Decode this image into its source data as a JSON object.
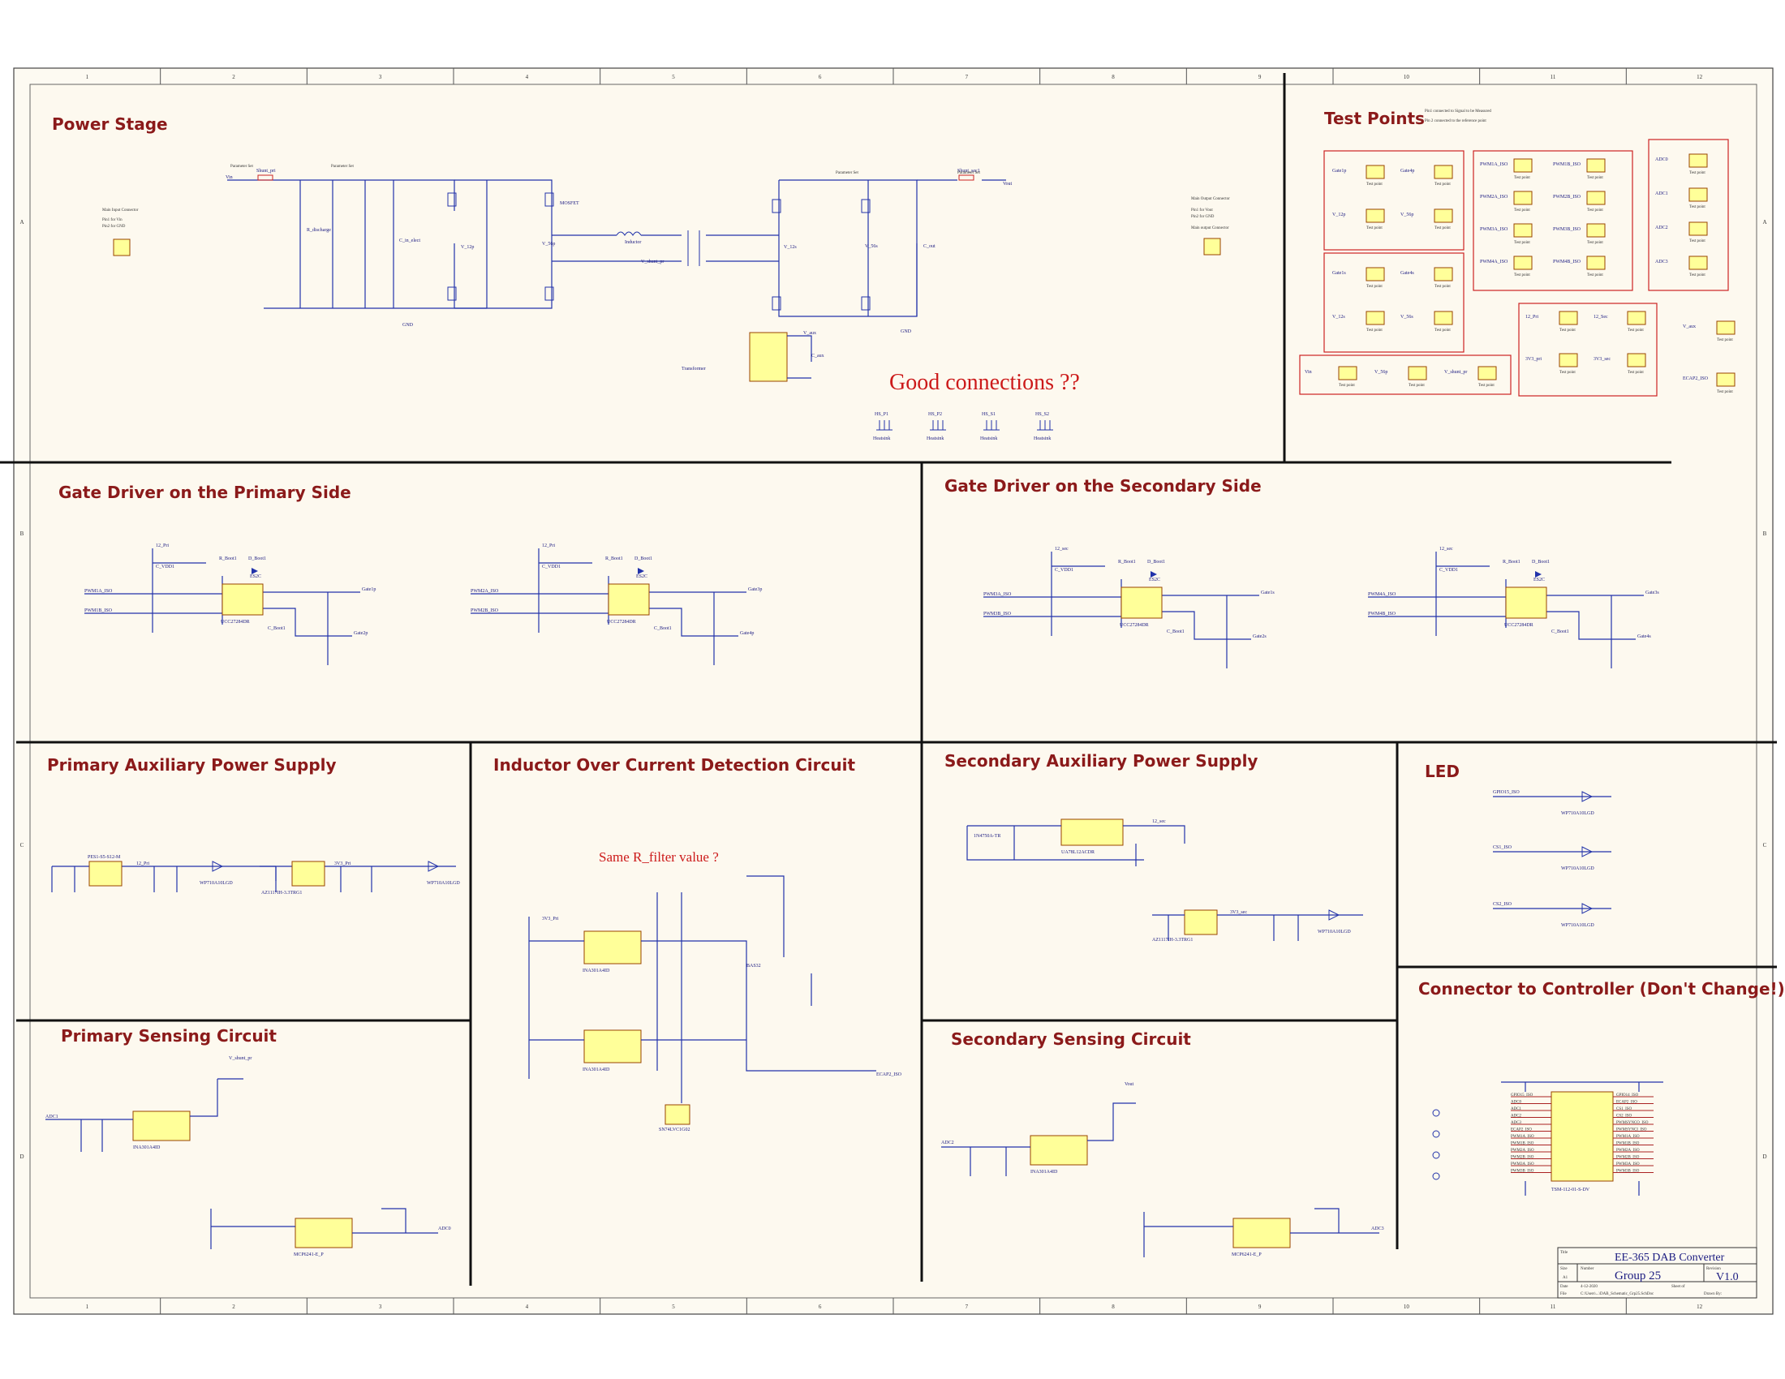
{
  "sections": {
    "power_stage": "Power Stage",
    "test_points": "Test Points",
    "gate_driver_primary": "Gate Driver on the Primary Side",
    "gate_driver_secondary": "Gate Driver on the Secondary Side",
    "primary_aux_supply": "Primary Auxiliary Power Supply",
    "inductor_oc": "Inductor Over Current Detection Circuit",
    "secondary_aux_supply": "Secondary Auxiliary Power Supply",
    "led": "LED",
    "primary_sensing": "Primary Sensing Circuit",
    "secondary_sensing": "Secondary Sensing Circuit",
    "connector_controller": "Connector to Controller (Don't Change!)"
  },
  "notes": {
    "good_connections": "Good connections ??",
    "same_r_filter": "Same R_filter value ?"
  },
  "power_stage": {
    "main_input_connector": "Main Input Connector",
    "pin1_vin": "Pin1 for Vin",
    "pin2_gnd": "Pin2 for GND",
    "main_output_connector": "Main Output Connector",
    "pin1_vout": "Pin1 for Vout",
    "pin2_gnd_out": "Pin2 for GND",
    "main_output_connector_2": "Main output Connector",
    "transformer": "Transformer",
    "inductor": "Inductor",
    "mosfet": "MOSFET",
    "heatsink": "Heatsink",
    "vin": "Vin",
    "vout": "Vout",
    "gnd": "GND",
    "shunt_pri": "Shunt_pri",
    "shunt_sec": "Shunt_sec1",
    "r_discharge": "R_discharge",
    "c_in_electrolytic": "C_in_elect",
    "c_out": "C_out",
    "c_aux": "C_aux",
    "parameter_set": "Parameter Set",
    "v_shunt_pr": "V_shunt_pr",
    "v_12p": "V_12p",
    "v_56p": "V_56p",
    "v_12s": "V_12s",
    "v_56s": "V_56s",
    "v_aux": "V_aux",
    "heatsink_refs": [
      "HS_P1",
      "HS_P2",
      "HS_S1",
      "HS_S2"
    ]
  },
  "test_points": {
    "pin1_note": "Pin1 connected to Signal to be Measured",
    "pin2_note": "Pin 2 connected to the reference point",
    "test_point_label": "Test point",
    "group_a": [
      "Gate1p",
      "Gate4p",
      "V_12p",
      "V_56p"
    ],
    "group_b": [
      "Gate1s",
      "Gate4s",
      "V_12s",
      "V_56s"
    ],
    "group_c": [
      "PWM1A_ISO",
      "PWM1B_ISO",
      "PWM2A_ISO",
      "PWM2B_ISO",
      "PWM3A_ISO",
      "PWM3B_ISO",
      "PWM4A_ISO",
      "PWM4B_ISO"
    ],
    "group_d": [
      "ADC0",
      "ADC1",
      "ADC2",
      "ADC3"
    ],
    "group_e": [
      "12_Pri",
      "12_Sec",
      "3V3_pri",
      "3V3_sec"
    ],
    "group_f": [
      "Vin",
      "V_56p",
      "V_shunt_pr"
    ],
    "single": [
      "V_aux",
      "ECAP2_ISO"
    ]
  },
  "gate_driver": {
    "driver_ic": "UCC27284DR",
    "diode": "ES2C",
    "pwm_1a": "PWM1A_ISO",
    "pwm_1b": "PWM1B_ISO",
    "pwm_2a": "PWM2A_ISO",
    "pwm_2b": "PWM2B_ISO",
    "pwm_3a": "PWM3A_ISO",
    "pwm_3b": "PWM3B_ISO",
    "pwm_4a": "PWM4A_ISO",
    "pwm_4b": "PWM4B_ISO",
    "rail_pri": "12_Pri",
    "rail_sec": "12_sec",
    "c_vdd": "C_VDD1",
    "r_boot": "R_Boot1",
    "d_boot": "D_Boot1",
    "c_boot": "C_Boot1",
    "gate_1p": "Gate1p",
    "gate_2p": "Gate2p",
    "gate_3p": "Gate3p",
    "gate_4p": "Gate4p",
    "gate_1s": "Gate1s",
    "gate_2s": "Gate2s",
    "gate_3s": "Gate3s",
    "gate_4s": "Gate4s"
  },
  "aux_supply": {
    "dcdc": "PES1-S5-S12-M",
    "ldo": "AZ1117IH-3.3TRG1",
    "led_part": "WP710A10LGD",
    "reg_sec": "UA78L12ACDR",
    "zener": "1N4750A-TR",
    "rail_12": "12_Pri",
    "rail_3v3": "3V3_Pri",
    "rail_12s": "12_sec",
    "rail_3v3s": "3V3_sec"
  },
  "inductor_oc": {
    "amp": "INA301A4ID",
    "latch": "SN74LVC1G02",
    "out": "ECAP2_ISO",
    "rail": "3V3_Pri",
    "diode": "BAS32"
  },
  "led": {
    "gpio": "GPIO15_ISO",
    "cs1": "CS1_ISO",
    "cs2": "CS2_ISO",
    "part": "WP710A10LGD"
  },
  "sensing": {
    "adc1": "ADC1",
    "adc0": "ADC0",
    "adc2": "ADC2",
    "adc3": "ADC3",
    "amp": "INA301A4ID",
    "opamp": "MCP6241-E_P",
    "v_shunt_pr": "V_shunt_pr",
    "vout": "Vout"
  },
  "connector": {
    "part": "TSM-112-01-S-DV",
    "left_pins": [
      "GPIO15_ISO",
      "ADC0",
      "ADC1",
      "ADC2",
      "ADC3",
      "ECAP2_ISO",
      "PWM1A_ISO",
      "PWM1B_ISO",
      "PWM2A_ISO",
      "PWM2B_ISO",
      "PWM3A_ISO",
      "PWM3B_ISO"
    ],
    "right_pins": [
      "GPIO14_ISO",
      "ECAP2_ISO",
      "CS1_ISO",
      "CS2_ISO",
      "PWMSYNCO_ISO",
      "PWMSYNCI_ISO",
      "PWM1A_ISO",
      "PWM1B_ISO",
      "PWM2A_ISO",
      "PWM2B_ISO",
      "PWM3A_ISO",
      "PWM3B_ISO"
    ]
  },
  "title_block": {
    "title_label": "Title",
    "title": "EE-365 DAB Converter",
    "size_label": "Size",
    "size": "A1",
    "number_label": "Number",
    "number": "Group 25",
    "revision_label": "Revision",
    "revision": "V1.0",
    "date_label": "Date",
    "date": "4-12-2020",
    "sheet_label": "Sheet  of",
    "file_label": "File",
    "file": "C:\\Users\\...\\DAB_Schematic_Grp25.SchDoc",
    "drawn_label": "Drawn By:"
  },
  "border": {
    "columns": [
      "1",
      "2",
      "3",
      "4",
      "5",
      "6",
      "7",
      "8",
      "9",
      "10",
      "11",
      "12"
    ],
    "rows": [
      "A",
      "B",
      "C",
      "D"
    ]
  }
}
